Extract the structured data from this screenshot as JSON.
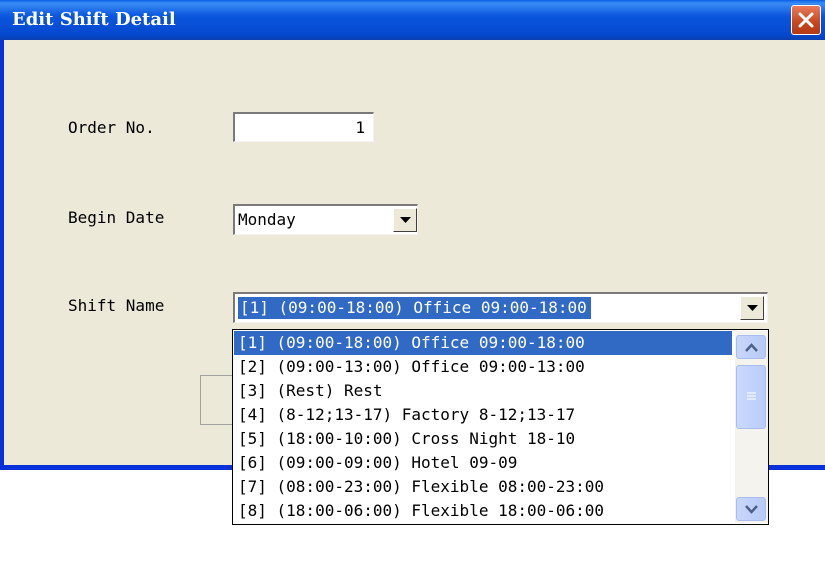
{
  "window": {
    "title": "Edit Shift Detail"
  },
  "form": {
    "order_label": "Order No.",
    "order_value": "1",
    "begin_date_label": "Begin Date",
    "begin_date_value": "Monday",
    "shift_name_label": "Shift Name",
    "shift_name_value": "[1]  (09:00-18:00) Office 09:00-18:00"
  },
  "shift_options": [
    "[1]  (09:00-18:00) Office 09:00-18:00",
    "[2]  (09:00-13:00) Office 09:00-13:00",
    "[3]  (Rest) Rest",
    "[4]  (8-12;13-17) Factory 8-12;13-17",
    "[5]  (18:00-10:00) Cross Night 18-10",
    "[6]  (09:00-09:00) Hotel 09-09",
    "[7]  (08:00-23:00) Flexible 08:00-23:00",
    "[8]  (18:00-06:00) Flexible 18:00-06:00"
  ],
  "colors": {
    "title_bar": "#0a56dd",
    "selection": "#316ac5",
    "dialog_bg": "#ece9d8"
  },
  "icons": {
    "close": "close-icon",
    "dropdown": "chevron-down-icon",
    "scroll_up": "arrow-up-icon",
    "scroll_down": "arrow-down-icon"
  }
}
